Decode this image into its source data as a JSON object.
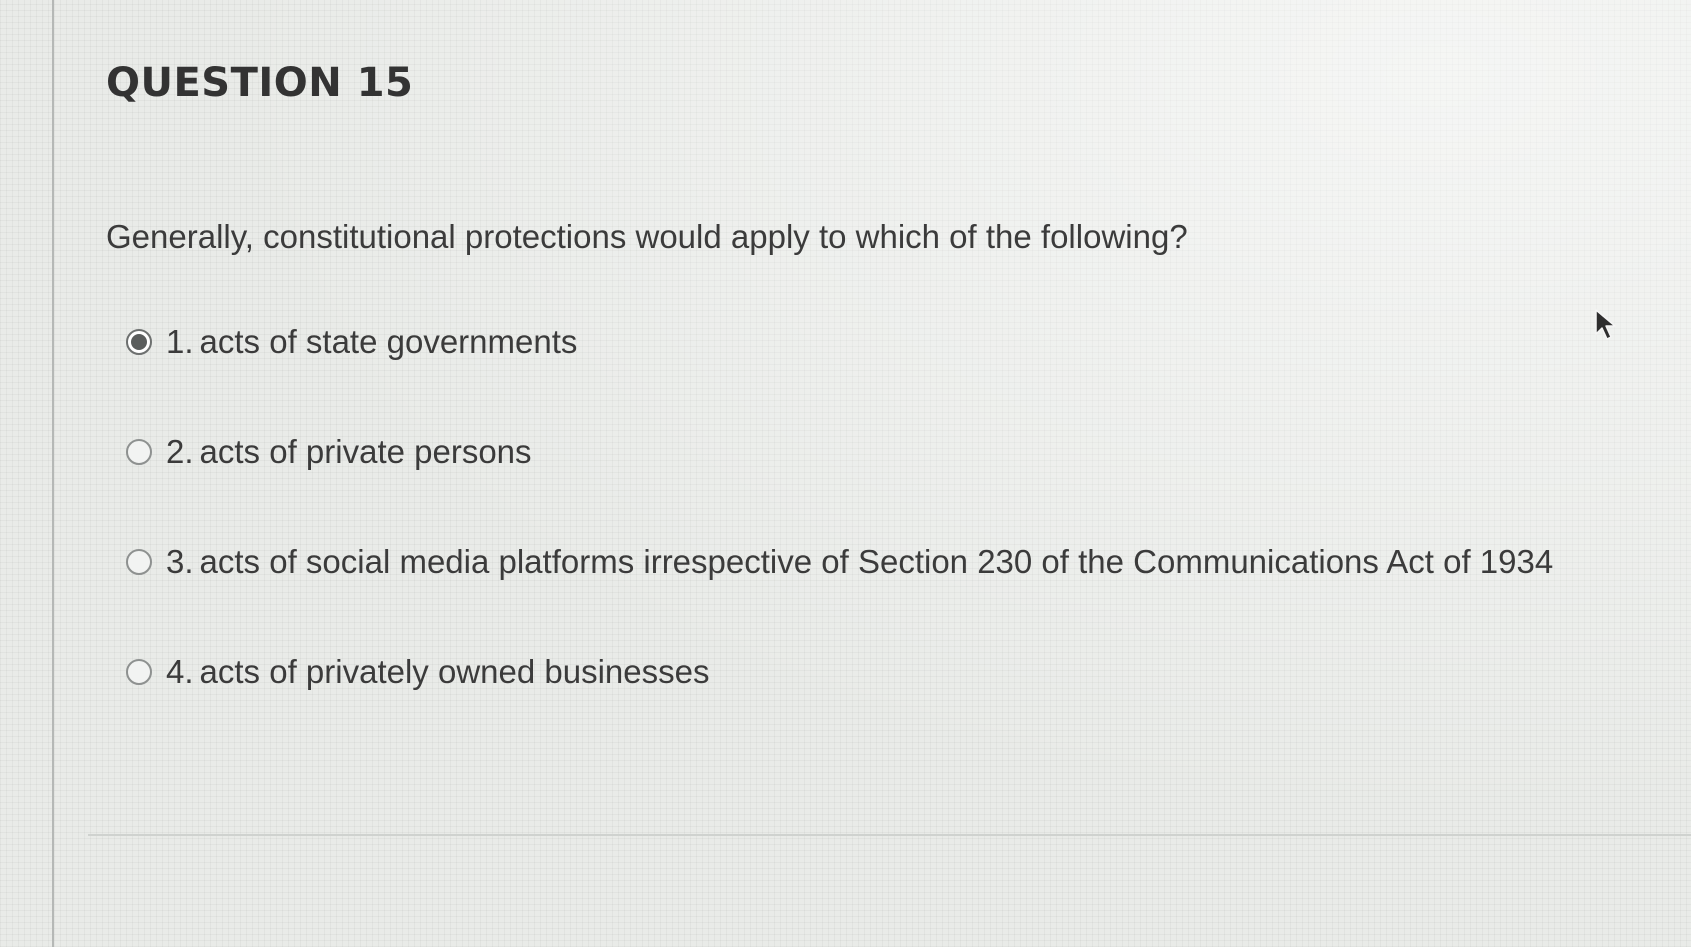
{
  "question": {
    "title": "QUESTION 15",
    "text": "Generally, constitutional protections would apply to which of the following?",
    "options": [
      {
        "number": "1.",
        "label": "acts of state governments",
        "selected": true
      },
      {
        "number": "2.",
        "label": "acts of private persons",
        "selected": false
      },
      {
        "number": "3.",
        "label": "acts of social media platforms irrespective of Section 230 of the Communications Act of 1934",
        "selected": false
      },
      {
        "number": "4.",
        "label": "acts of privately owned businesses",
        "selected": false
      }
    ]
  },
  "icons": {
    "cursor": "mouse-pointer-icon"
  },
  "colors": {
    "text": "#3b3b3b",
    "background": "#e9ebe8",
    "radio_border": "#8e9190",
    "radio_fill": "#5a5d5c"
  }
}
